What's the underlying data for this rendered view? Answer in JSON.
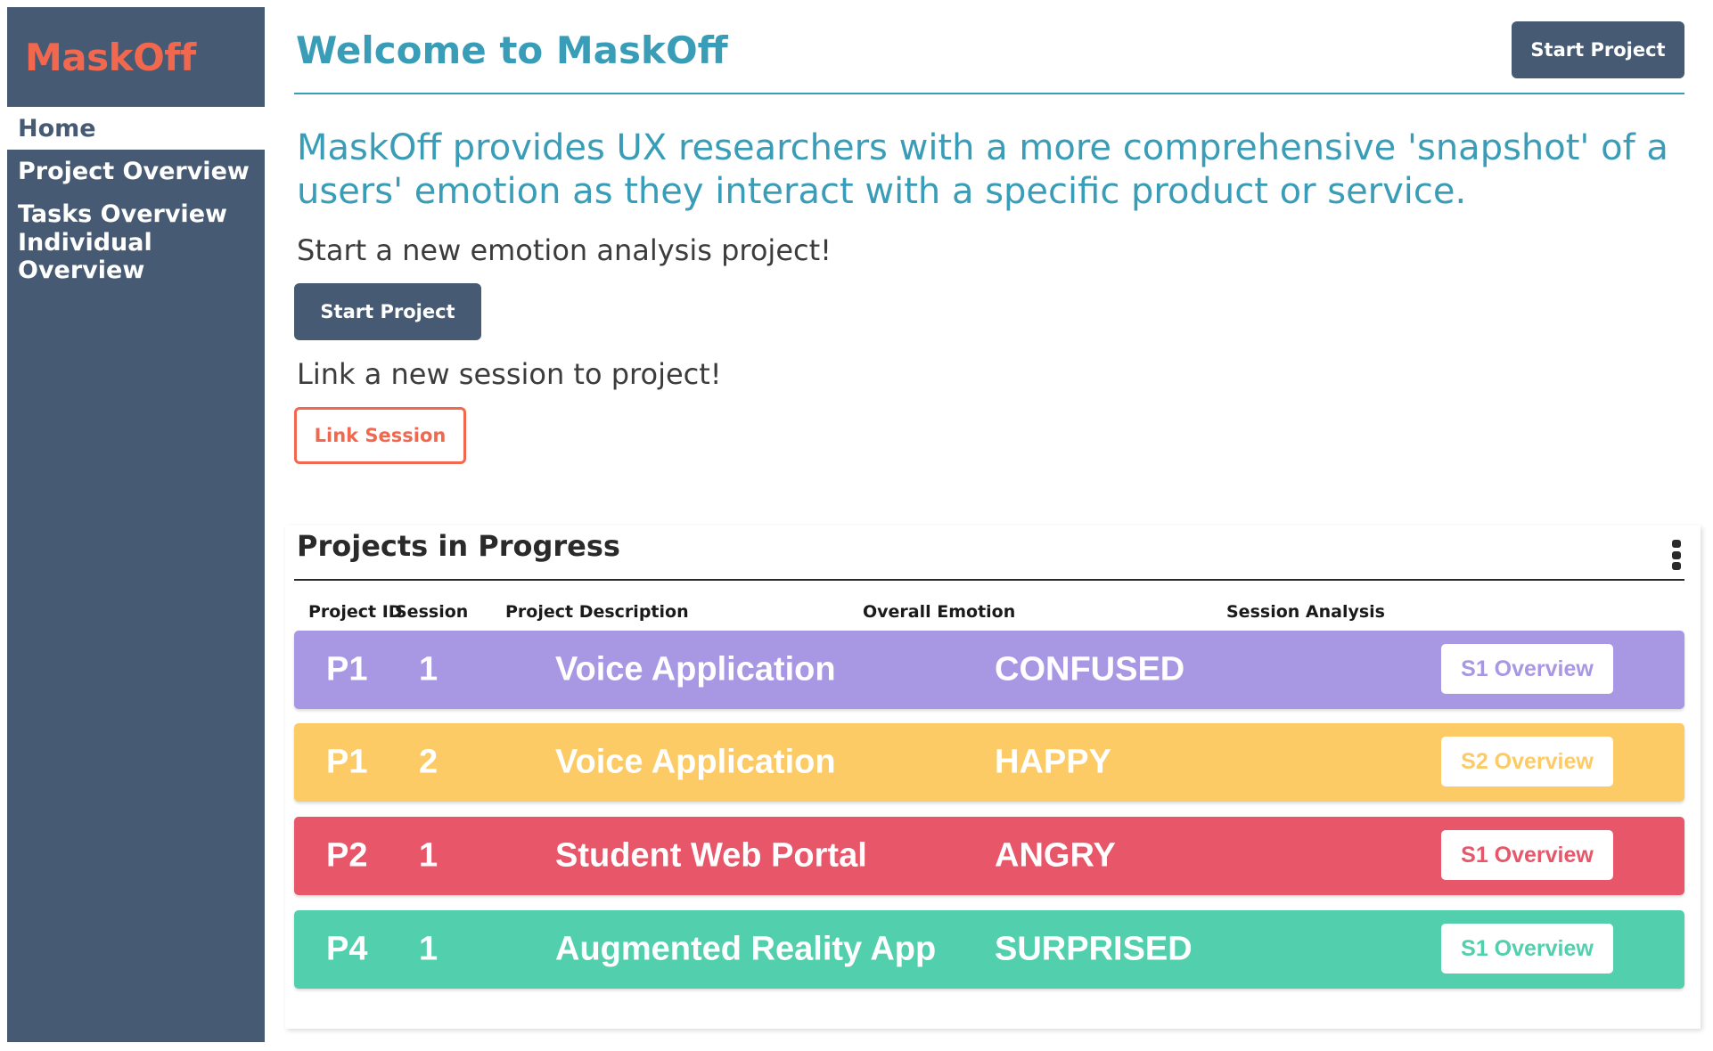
{
  "brand": {
    "logo_text": "MaskOff",
    "logo_color": "#f2684f"
  },
  "sidebar": {
    "background": "#465a73",
    "items": [
      {
        "label": "Home",
        "active": true
      },
      {
        "label": "Project Overview",
        "active": false
      },
      {
        "label": "Tasks Overview",
        "active": false
      },
      {
        "label": "Individual Overview",
        "active": false
      }
    ]
  },
  "header": {
    "title": "Welcome to MaskOff",
    "start_project_label": "Start Project"
  },
  "main": {
    "intro": "MaskOff provides UX researchers with a more comprehensive 'snapshot' of a users' emotion as they interact with a specific product or service.",
    "start_prompt": "Start a new emotion analysis project!",
    "start_button_label": "Start Project",
    "link_prompt": "Link a new session to project!",
    "link_button_label": "Link Session"
  },
  "projects": {
    "title": "Projects in Progress",
    "menu_icon": "kebab-menu-icon",
    "columns": {
      "project_id": "Project ID",
      "session": "Session",
      "description": "Project Description",
      "emotion": "Overall Emotion",
      "analysis": "Session Analysis"
    },
    "rows": [
      {
        "project_id": "P1",
        "session": "1",
        "description": "Voice Application",
        "emotion": "CONFUSED",
        "analysis_label": "S1 Overview",
        "color": "#a898e4"
      },
      {
        "project_id": "P1",
        "session": "2",
        "description": "Voice Application",
        "emotion": "HAPPY",
        "analysis_label": "S2 Overview",
        "color": "#fccb66"
      },
      {
        "project_id": "P2",
        "session": "1",
        "description": "Student Web Portal",
        "emotion": "ANGRY",
        "analysis_label": "S1 Overview",
        "color": "#e85669"
      },
      {
        "project_id": "P4",
        "session": "1",
        "description": "Augmented Reality App",
        "emotion": "SURPRISED",
        "analysis_label": "S1 Overview",
        "color": "#52cfac"
      }
    ]
  },
  "colors": {
    "accent": "#3a9db8",
    "primary_button": "#465a73",
    "outline_button": "#f2684f"
  }
}
